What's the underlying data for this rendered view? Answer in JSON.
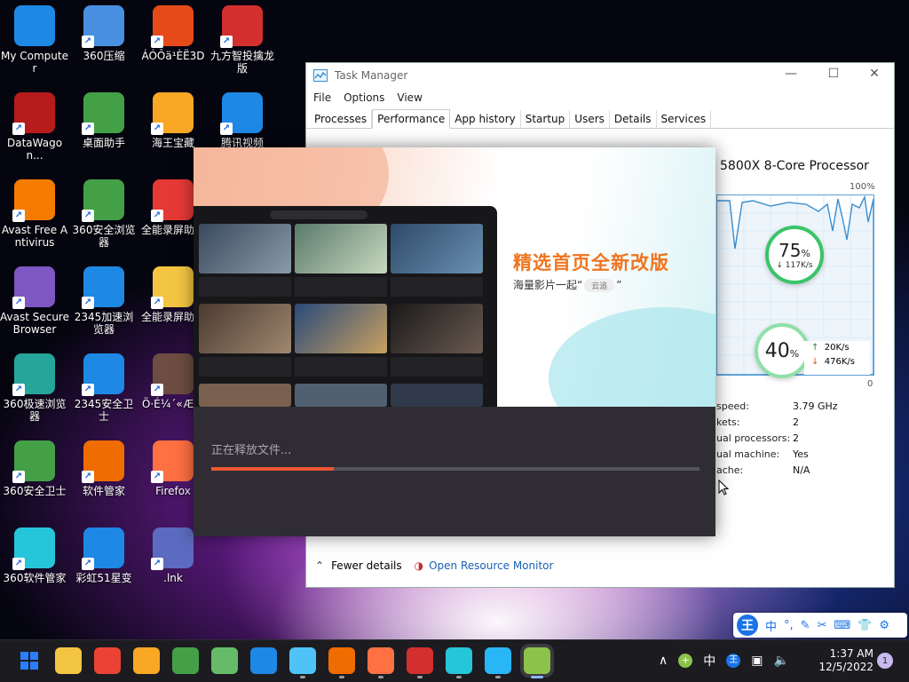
{
  "desktop": {
    "icons": [
      {
        "label": "My Computer",
        "icon": "computer-icon",
        "color": "#1e88e5"
      },
      {
        "label": "360压缩",
        "icon": "zip-archive-icon",
        "color": "#4a90e2"
      },
      {
        "label": "ÁÓÔä¹ÈË3D",
        "icon": "game-icon",
        "color": "#e64a19"
      },
      {
        "label": "九方智投擒龙版",
        "icon": "finance-app-icon",
        "color": "#d32f2f"
      },
      {
        "label": "DataWagon...",
        "icon": "datawagon-icon",
        "color": "#b71c1c"
      },
      {
        "label": "桌面助手",
        "icon": "desktop-assistant-icon",
        "color": "#43a047"
      },
      {
        "label": "海王宝藏",
        "icon": "game-icon",
        "color": "#f9a825"
      },
      {
        "label": "腾讯视频",
        "icon": "video-player-icon",
        "color": "#1e88e5"
      },
      {
        "label": "Avast Free Antivirus",
        "icon": "avast-icon",
        "color": "#f57c00"
      },
      {
        "label": "360安全浏览器",
        "icon": "browser-icon",
        "color": "#43a047"
      },
      {
        "label": "全能录屏助手",
        "icon": "screen-recorder-icon",
        "color": "#e53935"
      },
      {
        "label": "Avast Secure Browser",
        "icon": "secure-browser-icon",
        "color": "#7e57c2"
      },
      {
        "label": "2345加速浏览器",
        "icon": "browser-icon",
        "color": "#1e88e5"
      },
      {
        "label": "全能录屏助手",
        "icon": "folder-icon",
        "color": "#f4c542"
      },
      {
        "label": "360极速浏览器",
        "icon": "browser-icon",
        "color": "#26a69a"
      },
      {
        "label": "2345安全卫士",
        "icon": "shield-icon",
        "color": "#1e88e5"
      },
      {
        "label": "Ö·É¼´«Ææ",
        "icon": "game-icon",
        "color": "#6d4c41"
      },
      {
        "label": "360安全卫士",
        "icon": "shield-plus-icon",
        "color": "#43a047"
      },
      {
        "label": "软件管家",
        "icon": "app-store-icon",
        "color": "#ef6c00"
      },
      {
        "label": "Firefox",
        "icon": "firefox-icon",
        "color": "#ff7043"
      },
      {
        "label": "360软件管家",
        "icon": "app-store-icon",
        "color": "#26c6da"
      },
      {
        "label": "彩虹51星变",
        "icon": "app-window-icon",
        "color": "#1e88e5"
      },
      {
        "label": ".lnk",
        "icon": "shortcut-user-icon",
        "color": "#5c6bc0"
      }
    ]
  },
  "task_manager": {
    "title": "Task Manager",
    "menu": [
      "File",
      "Options",
      "View"
    ],
    "tabs": [
      "Processes",
      "Performance",
      "App history",
      "Startup",
      "Users",
      "Details",
      "Services"
    ],
    "active_tab": "Performance",
    "cpu_name": "5800X 8-Core Processor",
    "graph_max": "100%",
    "graph_min": "0",
    "stats": [
      {
        "key": "speed:",
        "value": "3.79 GHz"
      },
      {
        "key": "kets:",
        "value": "2"
      },
      {
        "key": "ual processors:",
        "value": "2"
      },
      {
        "key": "ual machine:",
        "value": "Yes"
      },
      {
        "key": "ache:",
        "value": "N/A"
      }
    ],
    "fewer_details": "Fewer details",
    "open_resource_monitor": "Open Resource Monitor"
  },
  "widget": {
    "cpu_pct": "75",
    "pct_sign": "%",
    "cpu_down": "↓ 117K/s",
    "mem_pct": "40",
    "up_speed": "20K/s",
    "down_speed": "476K/s"
  },
  "installer": {
    "headline": "精选首页全新改版",
    "subline_prefix": "海量影片一起“",
    "subline_chip": "云追",
    "subline_suffix": "”",
    "status": "正在释放文件...",
    "progress": 0.25,
    "accent": "#ee5533"
  },
  "ime": {
    "logo": "王",
    "buttons": [
      "中",
      "°,",
      "✎",
      "✂",
      "⌨",
      "👕",
      "⚙"
    ]
  },
  "taskbar": {
    "apps": [
      {
        "name": "start-button-icon",
        "color": "#2a7fff"
      },
      {
        "name": "file-explorer-icon",
        "color": "#f4c542"
      },
      {
        "name": "chrome-icon",
        "color": "#ea4335"
      },
      {
        "name": "avast-browser-icon",
        "color": "#f9a825"
      },
      {
        "name": "360-browser-icon",
        "color": "#43a047"
      },
      {
        "name": "360-safe-browser-icon",
        "color": "#66bb6a"
      },
      {
        "name": "2345-browser-icon",
        "color": "#1e88e5"
      },
      {
        "name": "task-manager-icon",
        "color": "#4fc3f7"
      },
      {
        "name": "software-manager-icon",
        "color": "#ef6c00"
      },
      {
        "name": "firefox-icon",
        "color": "#ff7043"
      },
      {
        "name": "finance-app-icon",
        "color": "#d32f2f"
      },
      {
        "name": "360-software-manager-icon",
        "color": "#26c6da"
      },
      {
        "name": "tencent-icon",
        "color": "#29b6f6"
      },
      {
        "name": "video-installer-icon",
        "color": "#8bc34a"
      }
    ],
    "tray": {
      "chevron": "∧",
      "ime_mode": "中"
    },
    "time": "1:37 AM",
    "date": "12/5/2022",
    "notifications": "1"
  }
}
